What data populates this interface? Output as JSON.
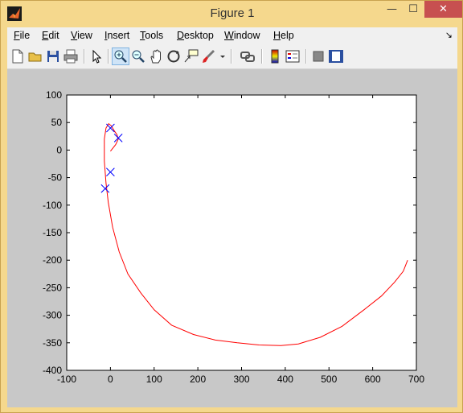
{
  "window": {
    "title": "Figure 1"
  },
  "menu": [
    "File",
    "Edit",
    "View",
    "Insert",
    "Tools",
    "Desktop",
    "Window",
    "Help"
  ],
  "dock_glyph": "↘",
  "toolbar": [
    "new-figure-icon",
    "open-file-icon",
    "save-icon",
    "print-icon",
    "edit-plot-arrow-icon",
    "zoom-in-icon",
    "zoom-out-icon",
    "pan-hand-icon",
    "rotate-3d-icon",
    "data-cursor-icon",
    "brush-icon",
    "brush-dropdown-icon",
    "link-plot-icon",
    "colorbar-icon",
    "legend-icon",
    "hide-plot-tools-icon",
    "show-plot-tools-icon"
  ],
  "chart_data": {
    "type": "line",
    "xlim": [
      -100,
      700
    ],
    "ylim": [
      -400,
      100
    ],
    "xticks": [
      "-100",
      "0",
      "100",
      "200",
      "300",
      "400",
      "500",
      "600",
      "700"
    ],
    "yticks": [
      "100",
      "50",
      "0",
      "-50",
      "-100",
      "-150",
      "-200",
      "-250",
      "-300",
      "-350",
      "-400"
    ],
    "grid": false,
    "series": [
      {
        "color": "#ff0000",
        "style": "line",
        "x": [
          0,
          12,
          18,
          15,
          8,
          2,
          -4,
          -10,
          -14,
          -14,
          -10,
          -5,
          5,
          20,
          40,
          70,
          100,
          140,
          190,
          240,
          290,
          340,
          390,
          430,
          480,
          530,
          580,
          620,
          650,
          670,
          680
        ],
        "y": [
          -2,
          10,
          20,
          28,
          36,
          44,
          48,
          40,
          20,
          -20,
          -60,
          -95,
          -140,
          -185,
          -225,
          -260,
          -290,
          -318,
          -335,
          -345,
          -350,
          -354,
          -355,
          -352,
          -340,
          -320,
          -290,
          -265,
          -240,
          -220,
          -200
        ]
      },
      {
        "color": "#0000ff",
        "style": "markers",
        "marker": "x",
        "x": [
          0,
          18,
          0,
          -12
        ],
        "y": [
          40,
          22,
          -40,
          -70
        ]
      }
    ]
  }
}
